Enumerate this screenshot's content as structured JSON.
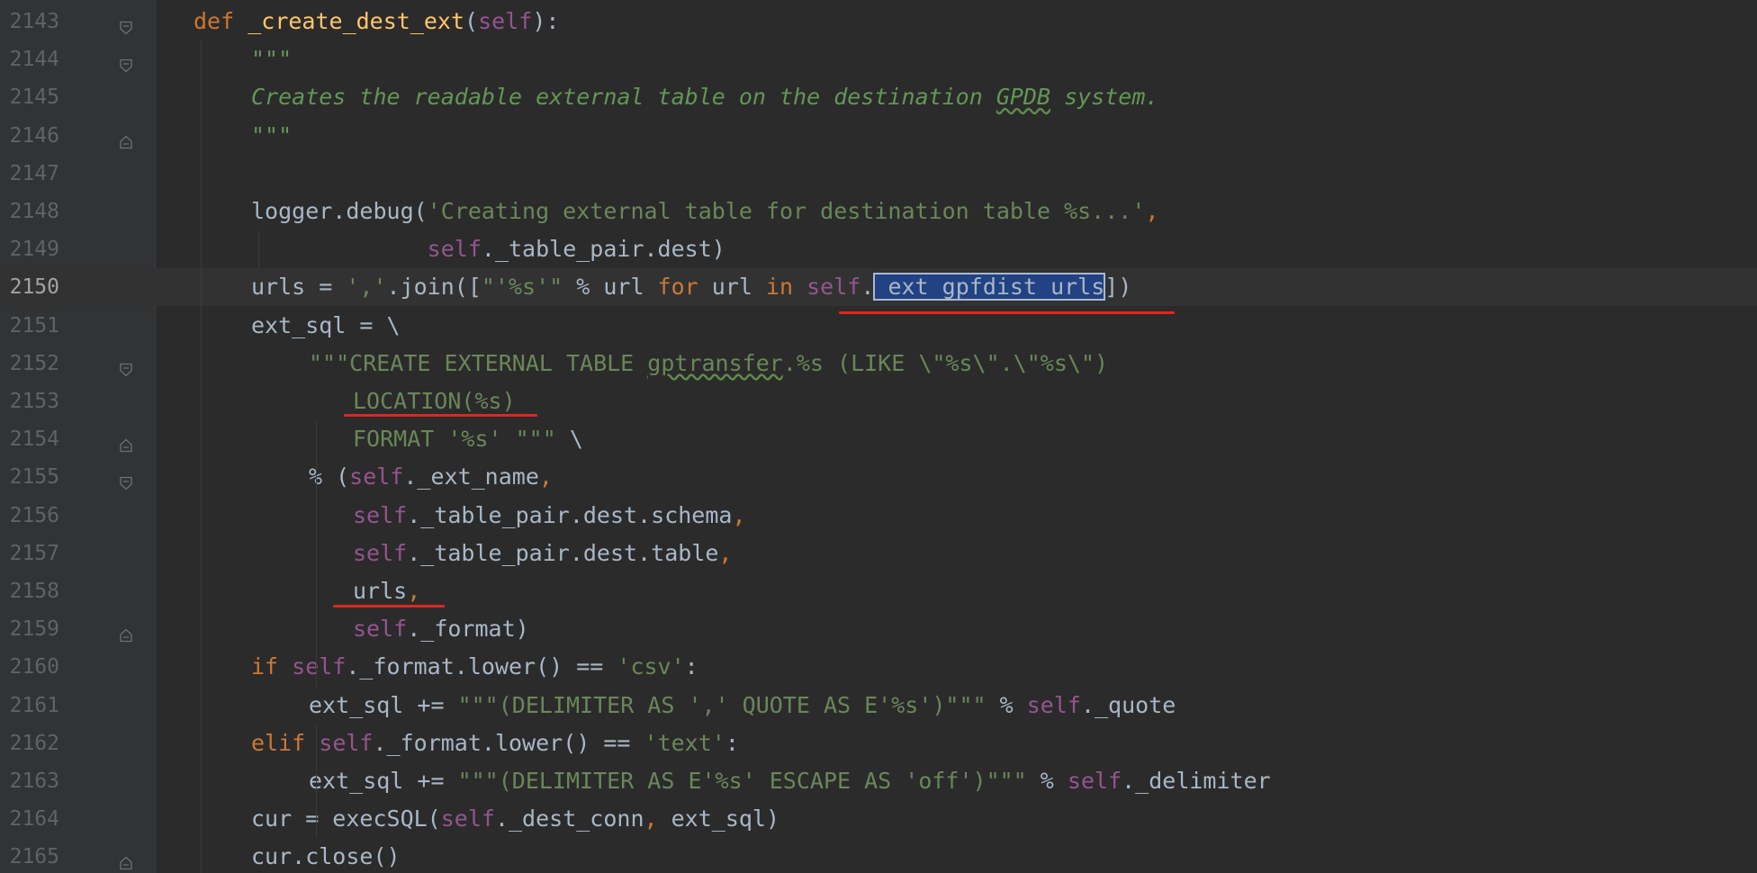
{
  "editor": {
    "current_line": 2150,
    "lines": [
      {
        "n": "2143",
        "fold": "open",
        "tokens": [
          [
            "kw",
            "def "
          ],
          [
            "fn",
            "_create_dest_ext"
          ],
          [
            "p",
            "("
          ],
          [
            "self",
            "self"
          ],
          [
            "p",
            "):"
          ]
        ]
      },
      {
        "n": "2144",
        "fold": "open",
        "tokens": [
          [
            "doc",
            "\"\"\""
          ]
        ]
      },
      {
        "n": "2145",
        "fold": "",
        "tokens": [
          [
            "doc",
            "Creates the readable external table on the destination "
          ],
          [
            "doc typo",
            "GPDB"
          ],
          [
            "doc",
            " system."
          ]
        ]
      },
      {
        "n": "2146",
        "fold": "end",
        "tokens": [
          [
            "doc",
            "\"\"\""
          ]
        ]
      },
      {
        "n": "2147",
        "fold": "",
        "tokens": []
      },
      {
        "n": "2148",
        "fold": "",
        "tokens": [
          [
            "p",
            "logger.debug("
          ],
          [
            "str",
            "'Creating external table for destination table %s...'"
          ],
          [
            "kw",
            ","
          ]
        ]
      },
      {
        "n": "2149",
        "fold": "",
        "tokens": [
          [
            "p",
            "             "
          ],
          [
            "self",
            "self"
          ],
          [
            "p",
            "._table_pair.dest)"
          ]
        ]
      },
      {
        "n": "2150",
        "fold": "",
        "tokens": [
          [
            "p",
            "urls = "
          ],
          [
            "str",
            "','"
          ],
          [
            "p",
            ".join(["
          ],
          [
            "str",
            "\"'%s'\""
          ],
          [
            "p",
            " % url "
          ],
          [
            "kw",
            "for"
          ],
          [
            "p",
            " url "
          ],
          [
            "kw",
            "in "
          ],
          [
            "self",
            "self"
          ],
          [
            "p",
            "."
          ],
          [
            "sel",
            "_ext_gpfdist_urls"
          ],
          [
            "p",
            "])"
          ]
        ]
      },
      {
        "n": "2151",
        "fold": "",
        "tokens": [
          [
            "p",
            "ext_sql = \\"
          ]
        ]
      },
      {
        "n": "2152",
        "fold": "open",
        "tokens": [
          [
            "str",
            "\"\"\"CREATE EXTERNAL TABLE "
          ],
          [
            "str typo",
            "gptransfer"
          ],
          [
            "str",
            ".%s (LIKE \\\"%s\\\".\\\"%s\\\")"
          ]
        ]
      },
      {
        "n": "2153",
        "fold": "",
        "tokens": [
          [
            "str",
            "LOCATION(%s)"
          ]
        ]
      },
      {
        "n": "2154",
        "fold": "end",
        "tokens": [
          [
            "str",
            "FORMAT '%s' \"\"\""
          ],
          [
            "p",
            " \\"
          ]
        ]
      },
      {
        "n": "2155",
        "fold": "open",
        "tokens": [
          [
            "p",
            "% ("
          ],
          [
            "self",
            "self"
          ],
          [
            "p",
            "._ext_name"
          ],
          [
            "kw",
            ","
          ]
        ]
      },
      {
        "n": "2156",
        "fold": "",
        "tokens": [
          [
            "self",
            "self"
          ],
          [
            "p",
            "._table_pair.dest.schema"
          ],
          [
            "kw",
            ","
          ]
        ]
      },
      {
        "n": "2157",
        "fold": "",
        "tokens": [
          [
            "self",
            "self"
          ],
          [
            "p",
            "._table_pair.dest.table"
          ],
          [
            "kw",
            ","
          ]
        ]
      },
      {
        "n": "2158",
        "fold": "",
        "tokens": [
          [
            "p",
            "urls"
          ],
          [
            "kw",
            ","
          ]
        ]
      },
      {
        "n": "2159",
        "fold": "end",
        "tokens": [
          [
            "self",
            "self"
          ],
          [
            "p",
            "._format)"
          ]
        ]
      },
      {
        "n": "2160",
        "fold": "",
        "tokens": [
          [
            "kw",
            "if "
          ],
          [
            "self",
            "self"
          ],
          [
            "p",
            "._format.lower() == "
          ],
          [
            "str",
            "'csv'"
          ],
          [
            "p",
            ":"
          ]
        ]
      },
      {
        "n": "2161",
        "fold": "",
        "tokens": [
          [
            "p",
            "ext_sql += "
          ],
          [
            "str",
            "\"\"\"(DELIMITER AS ',' QUOTE AS E'%s')\"\"\""
          ],
          [
            "p",
            " % "
          ],
          [
            "self",
            "self"
          ],
          [
            "p",
            "._quote"
          ]
        ]
      },
      {
        "n": "2162",
        "fold": "",
        "tokens": [
          [
            "kw",
            "elif "
          ],
          [
            "self",
            "self"
          ],
          [
            "p",
            "._format.lower() == "
          ],
          [
            "str",
            "'text'"
          ],
          [
            "p",
            ":"
          ]
        ]
      },
      {
        "n": "2163",
        "fold": "",
        "tokens": [
          [
            "p",
            "ext_sql += "
          ],
          [
            "str",
            "\"\"\"(DELIMITER AS E'%s' ESCAPE AS 'off')\"\"\""
          ],
          [
            "p",
            " % "
          ],
          [
            "self",
            "self"
          ],
          [
            "p",
            "._delimiter"
          ]
        ]
      },
      {
        "n": "2164",
        "fold": "",
        "tokens": [
          [
            "p",
            "cur = execSQL("
          ],
          [
            "self",
            "self"
          ],
          [
            "p",
            "._dest_conn"
          ],
          [
            "kw",
            ", "
          ],
          [
            "p",
            "ext_sql)"
          ]
        ]
      },
      {
        "n": "2165",
        "fold": "end",
        "tokens": [
          [
            "p",
            "cur.close()"
          ]
        ]
      }
    ]
  }
}
